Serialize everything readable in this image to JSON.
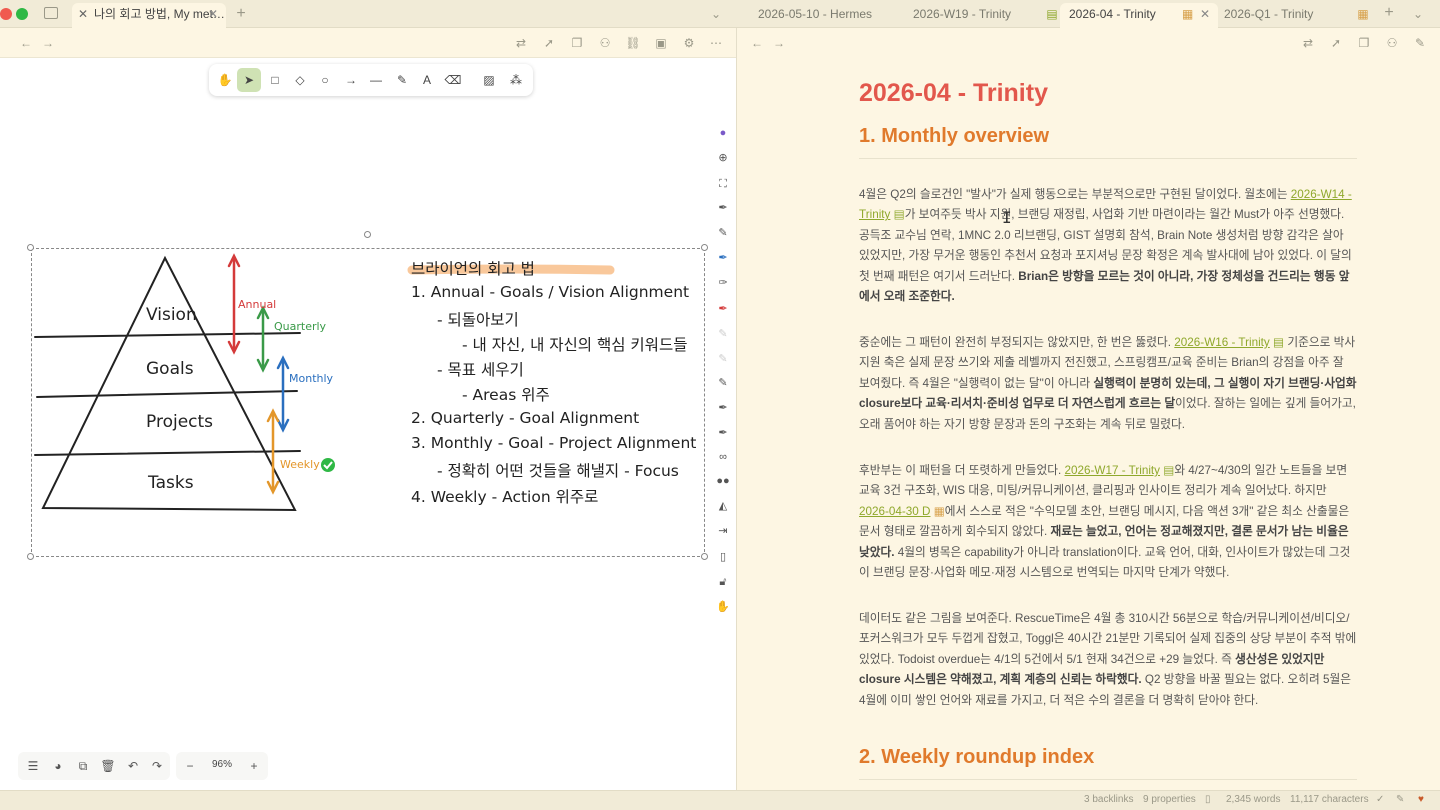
{
  "titlebar": {
    "tabs": [
      {
        "label": "나의 회고 방법, My met…",
        "active": true
      },
      {
        "label": "2026-05-10 - Hermes",
        "active": false
      },
      {
        "label": "2026-W19 - Trinity",
        "active": false
      },
      {
        "label": "2026-04 - Trinity",
        "active": true
      },
      {
        "label": "2026-Q1 - Trinity",
        "active": false
      }
    ]
  },
  "canvas": {
    "zoom": "96%",
    "pyramid": {
      "levels": [
        "Vision",
        "Goals",
        "Projects",
        "Tasks"
      ],
      "arrows": [
        "Annual",
        "Quarterly",
        "Monthly",
        "Weekly"
      ]
    },
    "notes": {
      "title": "브라이언의 회고 법",
      "lines": [
        "1. Annual - Goals / Vision Alignment",
        "- 되돌아보기",
        "- 내 자신, 내 자신의 핵심 키워드들",
        "- 목표 세우기",
        "- Areas 위주",
        "2. Quarterly - Goal Alignment",
        "3. Monthly - Goal - Project Alignment",
        "- 정확히 어떤 것들을 해낼지 - Focus",
        "4. Weekly - Action 위주로"
      ]
    }
  },
  "document": {
    "title": "2026-04 - Trinity",
    "section1": "1. Monthly overview",
    "section2": "2. Weekly roundup index",
    "links": {
      "w14": "2026-W14 - Trinity",
      "w16": "2026-W16 - Trinity",
      "w17": "2026-W17 - Trinity",
      "d0430": "2026-04-30 D"
    },
    "p1": {
      "a": "4월은 Q2의 슬로건인 \"발사\"가 실제 행동으로는 부분적으로만 구현된 달이었다. 월초에는 ",
      "b": "가 보여주듯 박사 지원, 브랜딩 재정립, 사업화 기반 마련이라는 월간 Must가 아주 선명했다. 공득조 교수님 연락, 1MNC 2.0 리브랜딩, GIST 설명회 참석, Brain Note 생성처럼 방향 감각은 살아 있었지만, 가장 무거운 행동인 추천서 요청과 포지셔닝 문장 확정은 계속 발사대에 남아 있었다. 이 달의 첫 번째 패턴은 여기서 드러난다. ",
      "bold": "Brian은 방향을 모르는 것이 아니라, 가장 정체성을 건드리는 행동 앞에서 오래 조준한다."
    },
    "p2": {
      "a": "중순에는 그 패턴이 완전히 부정되지는 않았지만, 한 번은 뚫렸다. ",
      "b": " 기준으로 박사 지원 축은 실제 문장 쓰기와 제출 레벨까지 전진했고, 스프링캠프/교육 준비는 Brian의 강점을 아주 잘 보여줬다. 즉 4월은 \"실행력이 없는 달\"이 아니라 ",
      "bold": "실행력이 분명히 있는데, 그 실행이 자기 브랜딩·사업화 closure보다 교육·리서치·준비성 업무로 더 자연스럽게 흐르는 달",
      "c": "이었다. 잘하는 일에는 깊게 들어가고, 오래 품어야 하는 자기 방향 문장과 돈의 구조화는 계속 뒤로 밀렸다."
    },
    "p3": {
      "a": "후반부는 이 패턴을 더 또렷하게 만들었다. ",
      "b": "와 4/27~4/30의 일간 노트들을 보면 교육 3건 구조화, WIS 대응, 미팅/커뮤니케이션, 클리핑과 인사이트 정리가 계속 일어났다. 하지만 ",
      "c": "에서 스스로 적은 \"수익모델 초안, 브랜딩 메시지, 다음 액션 3개\" 같은 최소 산출물은 문서 형태로 깔끔하게 회수되지 않았다. ",
      "bold": "재료는 늘었고, 언어는 정교해졌지만, 결론 문서가 남는 비율은 낮았다.",
      "d": " 4월의 병목은 capability가 아니라 translation이다. 교육 언어, 대화, 인사이트가 많았는데 그것이 브랜딩 문장·사업화 메모·재정 시스템으로 번역되는 마지막 단계가 약했다."
    },
    "p4": {
      "a": "데이터도 같은 그림을 보여준다. RescueTime은 4월 총 310시간 56분으로 학습/커뮤니케이션/비디오/포커스워크가 모두 두껍게 잡혔고, Toggl은 40시간 21분만 기록되어 실제 집중의 상당 부분이 추적 밖에 있었다. Todoist overdue는 4/1의 5건에서 5/1 현재 34건으로 +29 늘었다. 즉 ",
      "bold": "생산성은 있었지만 closure 시스템은 약해졌고, 계획 계층의 신뢰는 하락했다.",
      "b": " Q2 방향을 바꿀 필요는 없다. 오히려 5월은 4월에 이미 쌓인 언어와 재료를 가지고, 더 적은 수의 결론을 더 명확히 닫아야 한다."
    }
  },
  "status": {
    "backlinks": "3 backlinks",
    "properties": "9 properties",
    "words": "2,345 words",
    "characters": "11,117 characters"
  },
  "colors": {
    "title": "#e2574c",
    "heading": "#e07a2c",
    "link": "#8fa82c",
    "arrow_annual": "#d43a3a",
    "arrow_quarterly": "#3a9a48",
    "arrow_monthly": "#2a6fbf",
    "arrow_weekly": "#e3962a"
  }
}
